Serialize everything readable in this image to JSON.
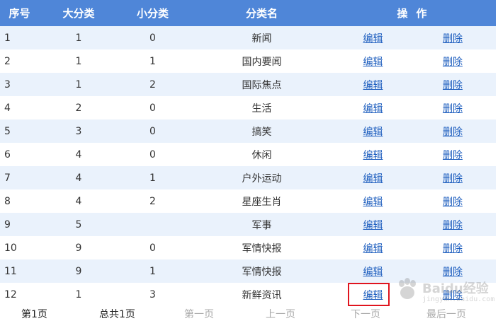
{
  "table": {
    "headers": {
      "seq": "序号",
      "major": "大分类",
      "minor": "小分类",
      "name": "分类名",
      "ops": "操作"
    },
    "edit_label": "编辑",
    "delete_label": "删除",
    "rows": [
      {
        "seq": "1",
        "major": "1",
        "minor": "0",
        "name": "新闻"
      },
      {
        "seq": "2",
        "major": "1",
        "minor": "1",
        "name": "国内要闻"
      },
      {
        "seq": "3",
        "major": "1",
        "minor": "2",
        "name": "国际焦点"
      },
      {
        "seq": "4",
        "major": "2",
        "minor": "0",
        "name": "生活"
      },
      {
        "seq": "5",
        "major": "3",
        "minor": "0",
        "name": "搞笑"
      },
      {
        "seq": "6",
        "major": "4",
        "minor": "0",
        "name": "休闲"
      },
      {
        "seq": "7",
        "major": "4",
        "minor": "1",
        "name": "户外运动"
      },
      {
        "seq": "8",
        "major": "4",
        "minor": "2",
        "name": "星座生肖"
      },
      {
        "seq": "9",
        "major": "5",
        "minor": "",
        "name": "军事"
      },
      {
        "seq": "10",
        "major": "9",
        "minor": "0",
        "name": "军情快报"
      },
      {
        "seq": "11",
        "major": "9",
        "minor": "1",
        "name": "军情快报"
      },
      {
        "seq": "12",
        "major": "1",
        "minor": "3",
        "name": "新鲜资讯"
      }
    ]
  },
  "pager": {
    "current": "第1页",
    "total": "总共1页",
    "first": "第一页",
    "prev": "上一页",
    "next": "下一页",
    "last": "最后一页"
  },
  "watermark": {
    "brand": "Baidu经验",
    "url": "jingyan.baidu.com"
  },
  "colors": {
    "header_bg": "#4f86d8",
    "row_alt_bg": "#eaf2fc",
    "link": "#1f5fbf",
    "highlight": "#e0141e"
  }
}
